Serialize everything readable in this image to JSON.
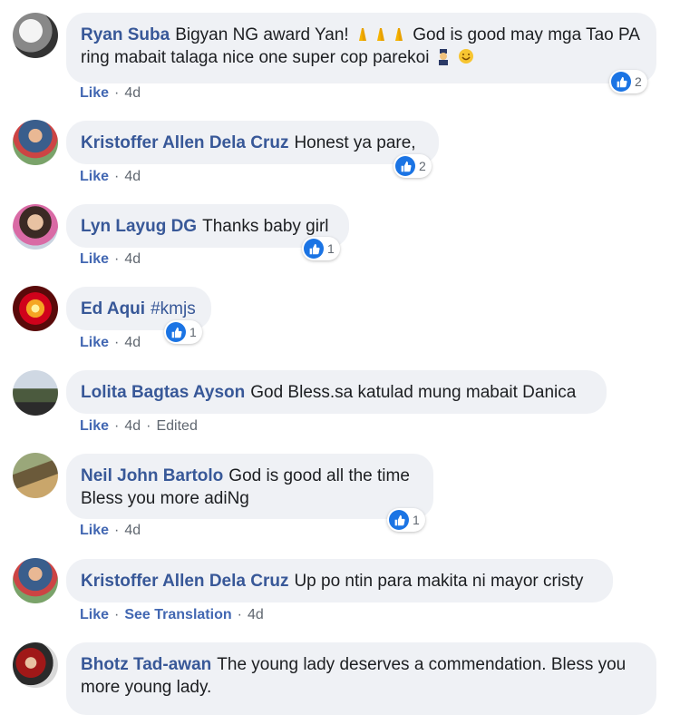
{
  "comments": [
    {
      "author": "Ryan Suba",
      "text_before": "Bigyan NG award Yan!",
      "text_after": "God is good may mga Tao PA ring mabait talaga nice one super cop parekoi",
      "like_label": "Like",
      "time": "4d",
      "reactions": "2",
      "icons": [
        "folded-hands-icon",
        "police-officer-icon",
        "smiling-face-icon"
      ]
    },
    {
      "author": "Kristoffer Allen Dela Cruz",
      "text": "Honest ya pare,",
      "like_label": "Like",
      "time": "4d",
      "reactions": "2"
    },
    {
      "author": "Lyn Layug DG",
      "text": "Thanks baby girl",
      "like_label": "Like",
      "time": "4d",
      "reactions": "1"
    },
    {
      "author": "Ed Aqui",
      "text": "#kmjs",
      "like_label": "Like",
      "time": "4d",
      "reactions": "1"
    },
    {
      "author": "Lolita Bagtas Ayson",
      "text": "God Bless.sa katulad mung mabait Danica",
      "like_label": "Like",
      "time": "4d",
      "edited": "Edited"
    },
    {
      "author": "Neil John Bartolo",
      "text": "God is good all the time Bless you more adiNg",
      "like_label": "Like",
      "time": "4d",
      "reactions": "1"
    },
    {
      "author": "Kristoffer Allen Dela Cruz",
      "text": "Up po ntin para makita ni mayor cristy",
      "like_label": "Like",
      "see_translation": "See Translation",
      "time": "4d"
    },
    {
      "author": "Bhotz Tad-awan",
      "text": "The young lady deserves a commendation. Bless you more young lady."
    }
  ],
  "colors": {
    "author": "#385898",
    "bubble": "#eff1f5",
    "like_action": "#4267b2",
    "like_reaction": "#1b74e4"
  }
}
